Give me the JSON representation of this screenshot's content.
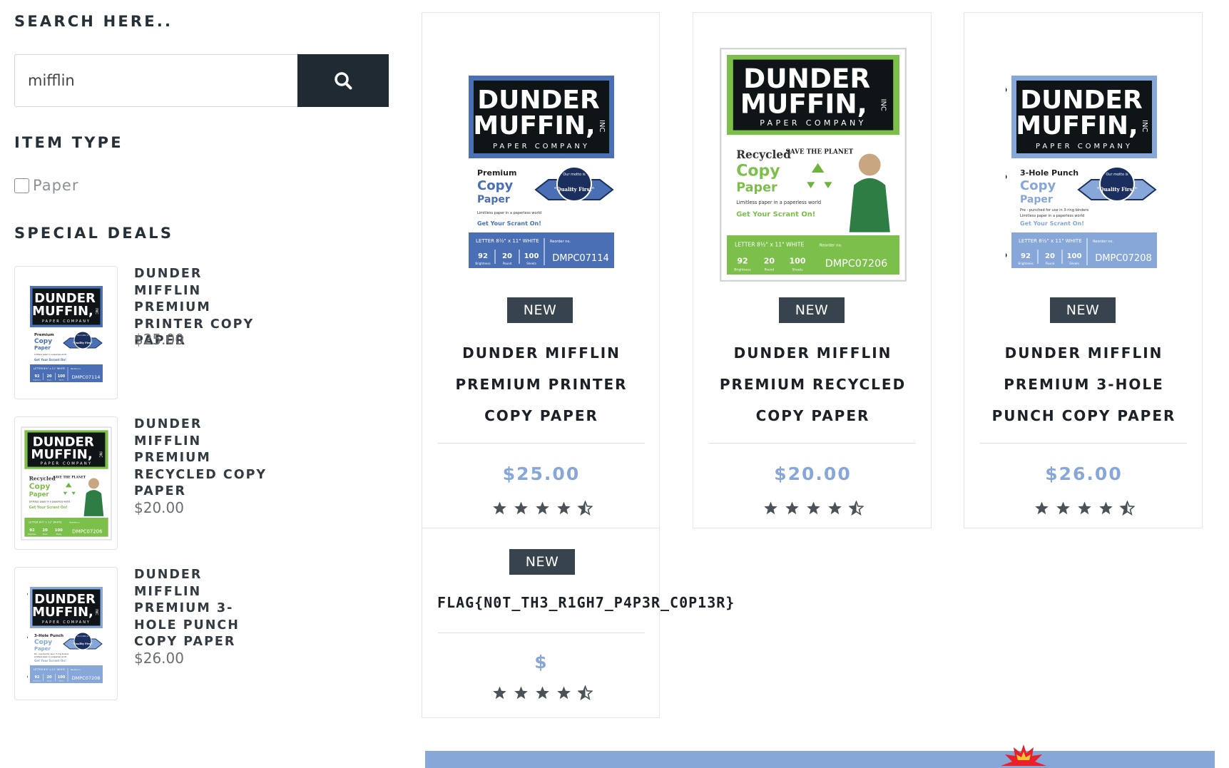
{
  "sidebar": {
    "search_heading": "SEARCH HERE..",
    "search_value": "mifflin",
    "search_icon": "search-icon",
    "item_type_heading": "ITEM TYPE",
    "filter_paper_label": "Paper",
    "special_deals_heading": "SPECIAL DEALS",
    "deals": [
      {
        "title": "DUNDER MIFFLIN PREMIUM PRINTER COPY PAPER",
        "price": "$25.00"
      },
      {
        "title": "DUNDER MIFFLIN PREMIUM RECYCLED COPY PAPER",
        "price": "$20.00"
      },
      {
        "title": "DUNDER MIFFLIN PREMIUM 3-HOLE PUNCH COPY PAPER",
        "price": "$26.00"
      }
    ]
  },
  "package": {
    "brand_line1": "DUNDER",
    "brand_line2": "MUFFIN,",
    "brand_inc": "INC",
    "subtitle": "PAPER COMPANY",
    "seal_top": "Our motto is",
    "seal_main": "\"Quality First\"",
    "tagline": "Limitless paper in a paperless world",
    "slogan": "Get Your Scrant On!",
    "spec": "LETTER 8½\" x 11\" WHITE",
    "reorder_label": "Reorder no.",
    "stat_brightness": "92",
    "stat_brightness_label": "Brightness",
    "stat_pound": "20",
    "stat_pound_label": "Pound",
    "stat_sheets": "100",
    "stat_sheets_label": "Sheets",
    "save_planet": "SAVE THE PLANET",
    "punch_note": "Pre - punched for use in 3-ring binders"
  },
  "products": [
    {
      "badge": "NEW",
      "title": "DUNDER MIFFLIN PREMIUM PRINTER COPY PAPER",
      "price": "$25.00",
      "rating": 4.5,
      "variant_line1": "Premium",
      "variant_line2": "Copy",
      "variant_line3": "Paper",
      "reorder_no": "DMPC07114",
      "theme": "#4a6fb5"
    },
    {
      "badge": "NEW",
      "title": "DUNDER MIFFLIN PREMIUM RECYCLED COPY PAPER",
      "price": "$20.00",
      "rating": 4.5,
      "variant_line1": "Recycled",
      "variant_line2": "Copy",
      "variant_line3": "Paper",
      "reorder_no": "DMPC07206",
      "theme": "#7cbf4a"
    },
    {
      "badge": "NEW",
      "title": "DUNDER MIFFLIN PREMIUM 3-HOLE PUNCH COPY PAPER",
      "price": "$26.00",
      "rating": 4.5,
      "variant_line1": "3-Hole Punch",
      "variant_line2": "Copy",
      "variant_line3": "Paper",
      "reorder_no": "DMPC07208",
      "theme": "#86a7d8"
    },
    {
      "badge": "NEW",
      "title": "FLAG{N0T_TH3_R1GH7_P4P3R_C0P13R}",
      "price": "$",
      "rating": 4.5
    }
  ],
  "colors": {
    "accent_price": "#86a7d8",
    "badge_bg": "#37444e",
    "search_btn": "#1f2a33"
  }
}
